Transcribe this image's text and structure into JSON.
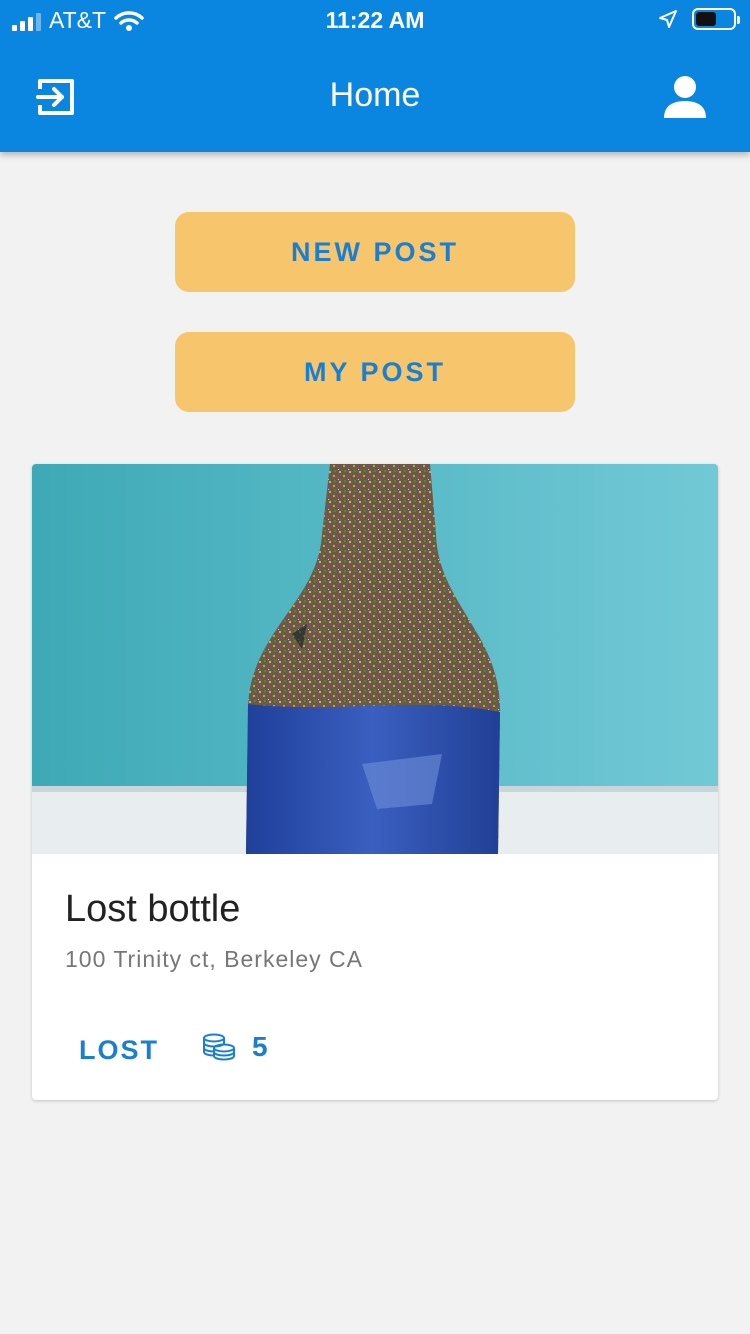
{
  "status_bar": {
    "carrier": "AT&T",
    "time": "11:22 AM"
  },
  "navbar": {
    "title": "Home",
    "left_icon": "logout-icon",
    "right_icon": "user-profile-icon"
  },
  "actions": {
    "new_post_label": "NEW POST",
    "my_post_label": "MY POST"
  },
  "post": {
    "title": "Lost bottle",
    "address": "100 Trinity ct, Berkeley CA",
    "status": "LOST",
    "reward_icon": "coins-icon",
    "reward": "5"
  },
  "colors": {
    "primary": "#0a86e0",
    "button_bg": "#f7c56b",
    "accent_text": "#1a7fd0",
    "background": "#f2f2f2"
  }
}
